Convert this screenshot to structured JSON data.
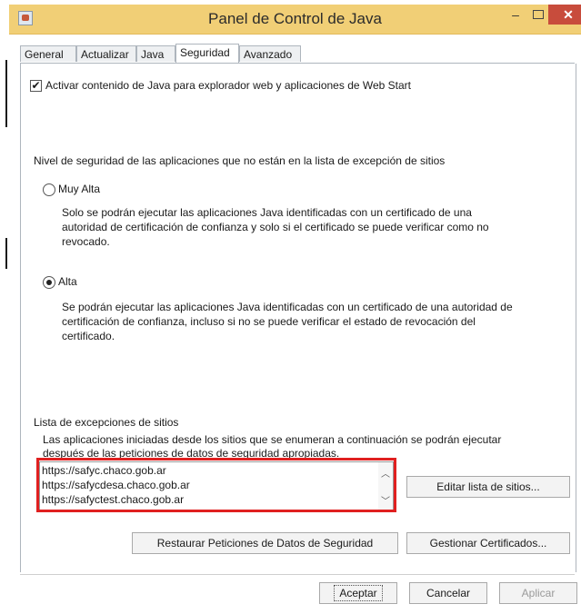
{
  "window": {
    "title": "Panel de Control de Java",
    "minimize_glyph": "–",
    "close_glyph": "✕"
  },
  "tabs": [
    {
      "label": "General"
    },
    {
      "label": "Actualizar"
    },
    {
      "label": "Java"
    },
    {
      "label": "Seguridad",
      "active": true
    },
    {
      "label": "Avanzado"
    }
  ],
  "security": {
    "enable_checkbox_label": "Activar contenido de Java para explorador web y aplicaciones de Web Start",
    "enable_checked": true,
    "level_heading": "Nivel de seguridad de las aplicaciones que no están en la lista de excepción de sitios",
    "very_high": {
      "label": "Muy Alta",
      "selected": false,
      "description": [
        "Solo se podrán ejecutar las aplicaciones Java identificadas con un certificado de una",
        "autoridad de certificación de confianza y solo si el certificado se puede verificar como no",
        "revocado."
      ]
    },
    "high": {
      "label": "Alta",
      "selected": true,
      "description": [
        "Se podrán ejecutar las aplicaciones Java identificadas con un certificado de una autoridad de",
        "certificación de confianza, incluso si no se puede verificar el estado de revocación del",
        "certificado."
      ]
    }
  },
  "exceptions": {
    "heading": "Lista de excepciones de sitios",
    "description": [
      "Las aplicaciones iniciadas desde los sitios que se enumeran a continuación se podrán ejecutar",
      "después de las peticiones de datos de seguridad apropiadas."
    ],
    "sites": [
      "https://safyc.chaco.gob.ar",
      "https://safycdesa.chaco.gob.ar",
      "https://safyctest.chaco.gob.ar"
    ],
    "edit_button": "Editar lista de sitios...",
    "highlight_color": "#e02020"
  },
  "actions": {
    "restore_button": "Restaurar Peticiones de Datos de Seguridad",
    "manage_certs_button": "Gestionar Certificados..."
  },
  "footer": {
    "accept_button": "Aceptar",
    "cancel_button": "Cancelar",
    "apply_button": "Aplicar"
  }
}
